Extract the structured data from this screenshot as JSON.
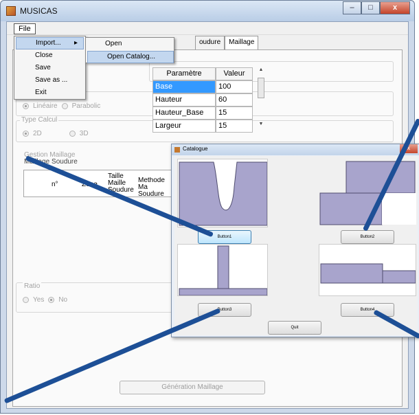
{
  "window": {
    "title": "MUSICAS",
    "minimize": "–",
    "maximize": "□",
    "close": "x"
  },
  "menubar": {
    "file": "File"
  },
  "file_menu": {
    "items": [
      "Import...",
      "Close",
      "Save",
      "Save as ...",
      "Exit"
    ],
    "submenu_arrow": "▸"
  },
  "import_submenu": {
    "items": [
      "Open",
      "Open Catalog..."
    ]
  },
  "tabs": [
    "oudure",
    "Maillage"
  ],
  "calc_group": {
    "options": [
      "Linéaire",
      "Parabolic"
    ]
  },
  "type_calcul": {
    "label": "Type Calcul",
    "options": [
      "2D",
      "3D"
    ]
  },
  "param_table": {
    "headers": [
      "Paramètre",
      "Valeur"
    ],
    "rows": [
      {
        "name": "Base",
        "value": "100"
      },
      {
        "name": "Hauteur",
        "value": "60"
      },
      {
        "name": "Hauteur_Base",
        "value": "15"
      },
      {
        "name": "Largeur",
        "value": "15"
      }
    ]
  },
  "gestion": {
    "label": "Gestion Maillage",
    "sublabel": "Maillage Soudure",
    "columns": [
      "n°",
      "Zone",
      "Taille Maille Soudure",
      "Methode Ma Soudure"
    ]
  },
  "ratio": {
    "label": "Ratio",
    "options": [
      "Yes",
      "No"
    ]
  },
  "generate_button": "Génération Maillage",
  "catalogue": {
    "title": "Catalogue",
    "buttons": [
      "Button1",
      "Button2",
      "Button3",
      "Button4"
    ],
    "quit": "Quit"
  },
  "colors": {
    "shape_fill": "#a8a4cc",
    "shape_stroke": "#4f4c6e",
    "callout": "#1d4f96",
    "selection": "#3399ff"
  }
}
